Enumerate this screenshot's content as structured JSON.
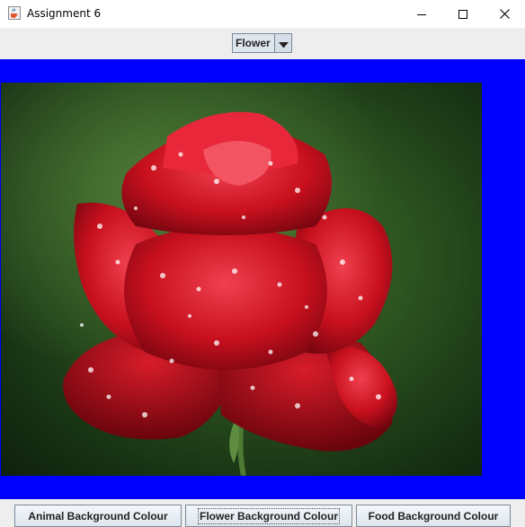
{
  "window": {
    "title": "Assignment 6",
    "icon": "java-cup-icon",
    "controls": {
      "minimize": "minimize-icon",
      "maximize": "maximize-icon",
      "close": "close-icon"
    }
  },
  "selector": {
    "selected": "Flower",
    "arrow_icon": "chevron-down-icon"
  },
  "content": {
    "background_color": "#0000ff",
    "image_subject": "red rose with water droplets"
  },
  "buttons": {
    "animal": "Animal Background Colour",
    "flower": "Flower Background Colour",
    "food": "Food Background Colour"
  }
}
